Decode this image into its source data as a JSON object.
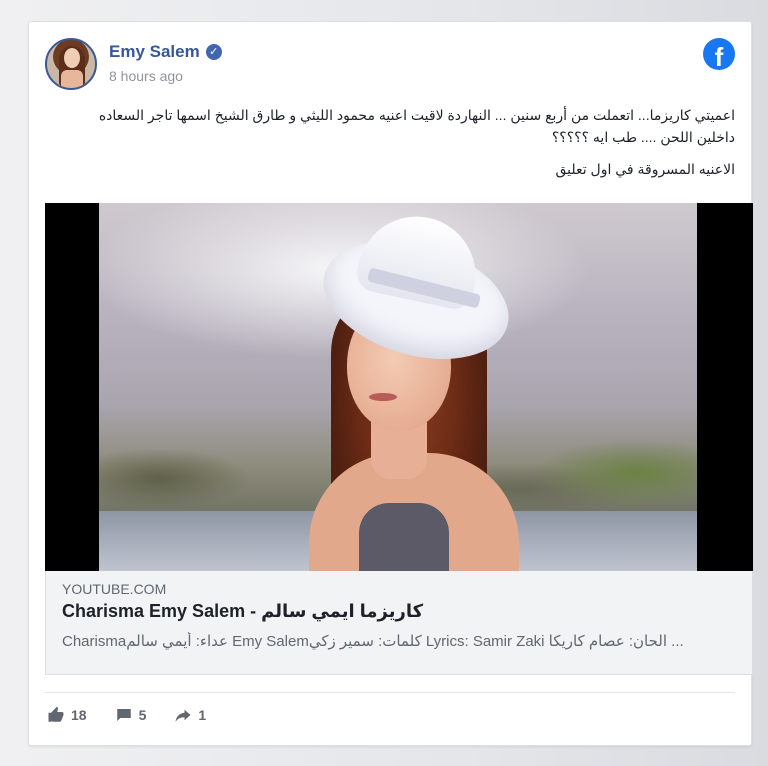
{
  "post": {
    "author": "Emy Salem",
    "timestamp": "8 hours ago",
    "text_lines": [
      "اعميتي كاريزما... اتعملت من أربع سنين ... النهاردة لاقيت اعنيه محمود الليثي و طارق الشيخ اسمها تاجر السعاده",
      "داخلين اللحن .... طب ايه ؟؟؟؟؟",
      "الاعنيه المسروقة في اول تعليق"
    ]
  },
  "link": {
    "source": "YOUTUBE.COM",
    "title": "Charisma Emy Salem - كاريزما ايمي سالم",
    "description": "... الحان: عصام كاريكا Lyrics: Samir Zaki كلمات: سمير زكيEmy Salem عداء: أيمي سالمCharisma"
  },
  "stats": {
    "likes": "18",
    "comments": "5",
    "shares": "1"
  },
  "colors": {
    "brand": "#1877f2",
    "author_link": "#365899"
  },
  "icons": {
    "platform": "facebook-icon",
    "verified": "verified-badge-icon",
    "like": "thumbs-up-icon",
    "comment": "comment-icon",
    "share": "share-arrow-icon"
  }
}
